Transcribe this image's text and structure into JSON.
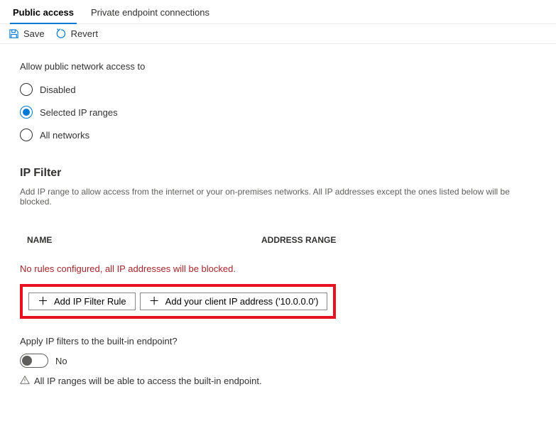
{
  "tabs": {
    "public": "Public access",
    "private": "Private endpoint connections"
  },
  "toolbar": {
    "save": "Save",
    "revert": "Revert"
  },
  "network": {
    "label": "Allow public network access to",
    "opt_disabled": "Disabled",
    "opt_selected": "Selected IP ranges",
    "opt_all": "All networks"
  },
  "ipfilter": {
    "title": "IP Filter",
    "desc": "Add IP range to allow access from the internet or your on-premises networks. All IP addresses except the ones listed below will be blocked.",
    "col_name": "NAME",
    "col_range": "ADDRESS RANGE",
    "empty_error": "No rules configured, all IP addresses will be blocked.",
    "add_rule": "Add IP Filter Rule",
    "add_client": "Add your client IP address ('10.0.0.0')"
  },
  "builtin": {
    "question": "Apply IP filters to the built-in endpoint?",
    "toggle_value": "No",
    "info": "All IP ranges will be able to access the built-in endpoint."
  }
}
